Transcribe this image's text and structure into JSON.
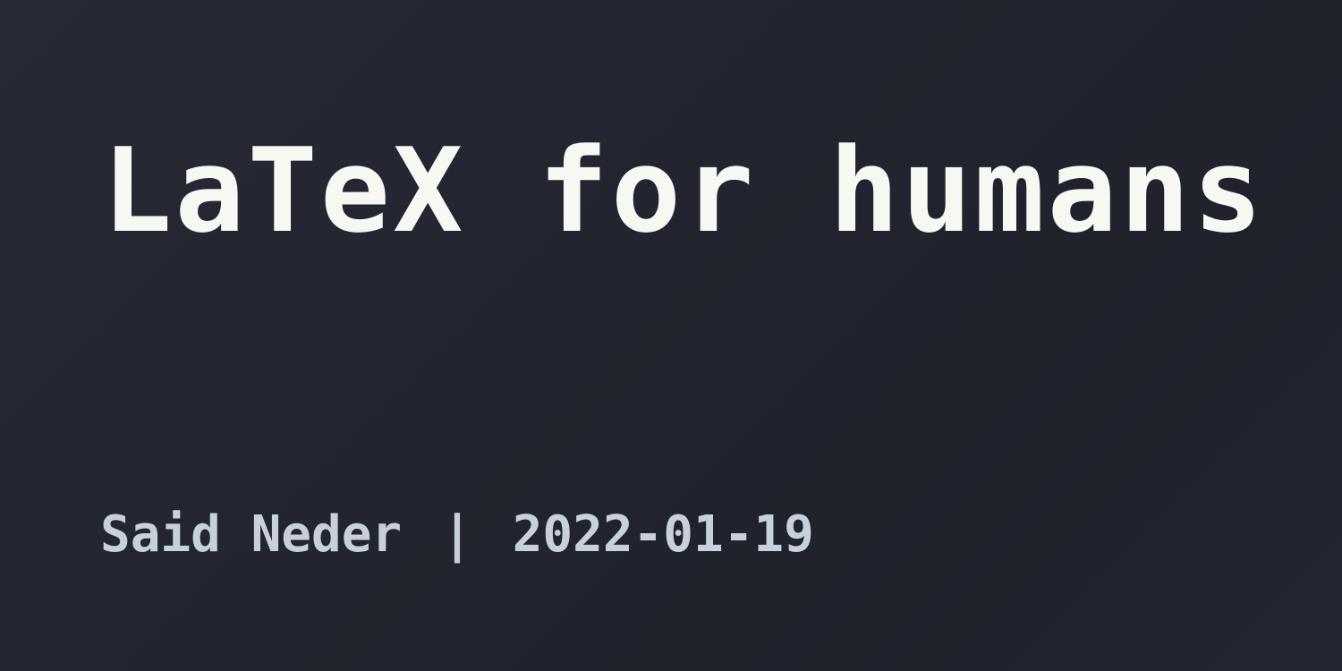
{
  "title": "LaTeX for humans",
  "byline": {
    "author": "Said Neder",
    "separator": "|",
    "date": "2022-01-19"
  },
  "colors": {
    "background": "#22242f",
    "title": "#f7f8f2",
    "byline": "#c8d0dc"
  }
}
